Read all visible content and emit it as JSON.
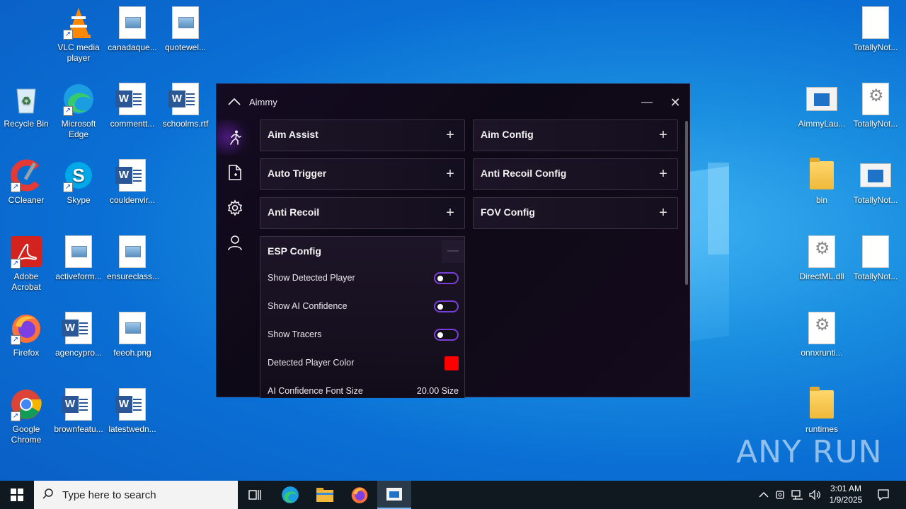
{
  "desktop": {
    "icons": [
      {
        "label": "VLC media player",
        "icon": "vlc-icon"
      },
      {
        "label": "canadaque...",
        "icon": "image-file-icon"
      },
      {
        "label": "quotewel...",
        "icon": "image-file-icon"
      },
      {
        "label": "Recycle Bin",
        "icon": "recycle-bin-icon"
      },
      {
        "label": "Microsoft Edge",
        "icon": "edge-icon"
      },
      {
        "label": "commentt...",
        "icon": "word-doc-icon"
      },
      {
        "label": "schoolms.rtf",
        "icon": "word-doc-icon"
      },
      {
        "label": "CCleaner",
        "icon": "ccleaner-icon"
      },
      {
        "label": "Skype",
        "icon": "skype-icon"
      },
      {
        "label": "couldenvir...",
        "icon": "word-doc-icon"
      },
      {
        "label": "Adobe Acrobat",
        "icon": "acrobat-icon"
      },
      {
        "label": "activeform...",
        "icon": "image-file-icon"
      },
      {
        "label": "ensureclass...",
        "icon": "image-file-icon"
      },
      {
        "label": "Firefox",
        "icon": "firefox-icon"
      },
      {
        "label": "agencypro...",
        "icon": "word-doc-icon"
      },
      {
        "label": "feeoh.png",
        "icon": "image-file-icon"
      },
      {
        "label": "Google Chrome",
        "icon": "chrome-icon"
      },
      {
        "label": "brownfeatu...",
        "icon": "word-doc-icon"
      },
      {
        "label": "latestwedn...",
        "icon": "word-doc-icon"
      },
      {
        "label": "TotallyNot...",
        "icon": "blank-file-icon"
      },
      {
        "label": "AimmyLau...",
        "icon": "app-window-icon"
      },
      {
        "label": "TotallyNot...",
        "icon": "settings-file-icon"
      },
      {
        "label": "bin",
        "icon": "folder-icon"
      },
      {
        "label": "TotallyNot...",
        "icon": "app-window-icon"
      },
      {
        "label": "DirectML.dll",
        "icon": "settings-file-icon"
      },
      {
        "label": "TotallyNot...",
        "icon": "blank-file-icon"
      },
      {
        "label": "onnxrunti...",
        "icon": "settings-file-icon"
      },
      {
        "label": "runtimes",
        "icon": "folder-icon"
      }
    ]
  },
  "app": {
    "title": "Aimmy",
    "minimize_label": "—",
    "close_label": "✕",
    "nav": [
      "runner-icon",
      "document-icon",
      "gear-icon",
      "user-icon"
    ],
    "left_cards": [
      "Aim Assist",
      "Auto Trigger",
      "Anti Recoil"
    ],
    "right_cards": [
      "Aim Config",
      "Anti Recoil Config",
      "FOV Config"
    ],
    "expand_label": "+",
    "collapse_label": "—",
    "esp": {
      "title": "ESP Config",
      "show_detected_player": "Show Detected Player",
      "show_ai_confidence": "Show AI Confidence",
      "show_tracers": "Show Tracers",
      "detected_player_color": "Detected Player Color",
      "player_color": "#ff0000",
      "font_size_label": "AI Confidence Font Size",
      "font_size_value": "20.00 Size",
      "toggles": {
        "show_detected_player": false,
        "show_ai_confidence": false,
        "show_tracers": false
      }
    }
  },
  "watermark": "ANY RUN",
  "taskbar": {
    "search_placeholder": "Type here to search",
    "time": "3:01 AM",
    "date": "1/9/2025"
  },
  "colors": {
    "accent": "#7a3ed8",
    "window_bg": "#120a1c",
    "desktop": "#0a6fd4"
  }
}
